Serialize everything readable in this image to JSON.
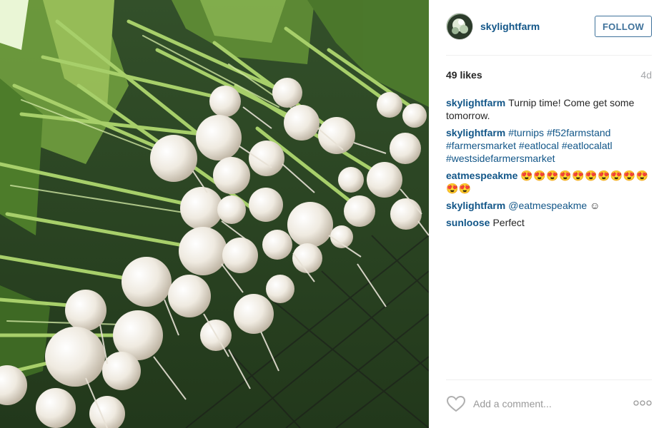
{
  "post": {
    "image_alt": "turnips",
    "username": "skylightfarm",
    "follow_label": "FOLLOW",
    "likes": "49 likes",
    "age": "4d",
    "comments": [
      {
        "author": "skylightfarm",
        "text": "Turnip time! Come get some tomorrow."
      },
      {
        "author": "skylightfarm",
        "tags": "#turnips #f52farmstand #farmersmarket #eatlocal #eatlocalatl #westsidefarmersmarket"
      },
      {
        "author": "eatmespeakme",
        "text": "😍😍😍😍😍😍😍😍😍😍😍😍"
      },
      {
        "author": "skylightfarm",
        "mention": "@eatmespeakme",
        "text": "☺"
      },
      {
        "author": "sunloose",
        "text": "Perfect"
      }
    ],
    "add_comment_placeholder": "Add a comment...",
    "icons": {
      "like": "heart-icon",
      "more": "more-options-icon"
    },
    "colors": {
      "link": "#125688",
      "follow": "#3f729b",
      "muted": "#a5a7aa"
    }
  }
}
